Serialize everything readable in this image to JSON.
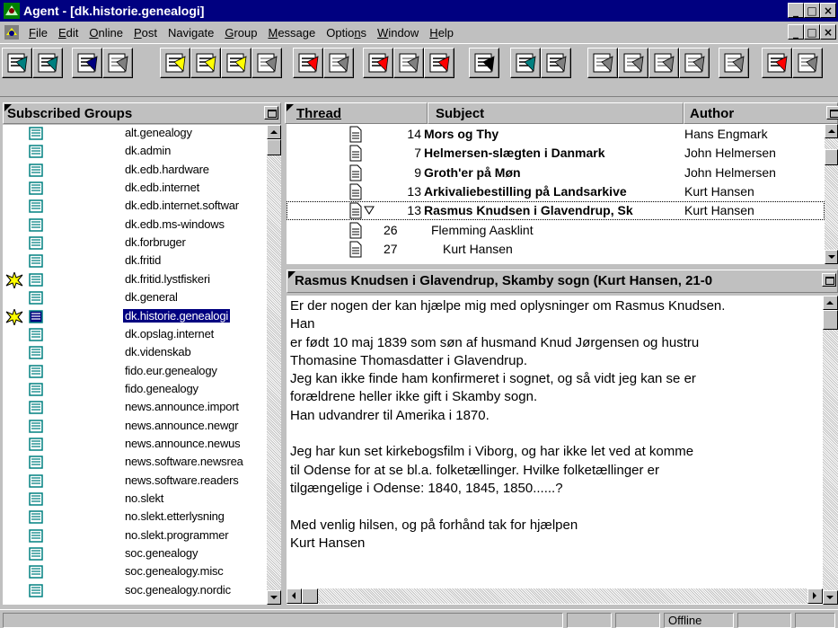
{
  "window": {
    "title": "Agent - [dk.historie.genealogi]"
  },
  "menu": [
    {
      "label": "File",
      "u": "F"
    },
    {
      "label": "Edit",
      "u": "E"
    },
    {
      "label": "Online",
      "u": "O"
    },
    {
      "label": "Post",
      "u": "P"
    },
    {
      "label": "Navigate",
      "u": "g"
    },
    {
      "label": "Group",
      "u": "G"
    },
    {
      "label": "Message",
      "u": "M"
    },
    {
      "label": "Options",
      "u": "n"
    },
    {
      "label": "Window",
      "u": "W"
    },
    {
      "label": "Help",
      "u": "H"
    }
  ],
  "groups_pane": {
    "title": "Subscribed Groups",
    "items": [
      {
        "name": "alt.genealogy"
      },
      {
        "name": "dk.admin"
      },
      {
        "name": "dk.edb.hardware"
      },
      {
        "name": "dk.edb.internet"
      },
      {
        "name": "dk.edb.internet.softwar"
      },
      {
        "name": "dk.edb.ms-windows"
      },
      {
        "name": "dk.forbruger"
      },
      {
        "name": "dk.fritid"
      },
      {
        "name": "dk.fritid.lystfiskeri",
        "new": true
      },
      {
        "name": "dk.general"
      },
      {
        "name": "dk.historie.genealogi",
        "new": true,
        "selected": true
      },
      {
        "name": "dk.opslag.internet"
      },
      {
        "name": "dk.videnskab"
      },
      {
        "name": "fido.eur.genealogy"
      },
      {
        "name": "fido.genealogy"
      },
      {
        "name": "news.announce.import"
      },
      {
        "name": "news.announce.newgr"
      },
      {
        "name": "news.announce.newus"
      },
      {
        "name": "news.software.newsrea"
      },
      {
        "name": "news.software.readers"
      },
      {
        "name": "no.slekt"
      },
      {
        "name": "no.slekt.etterlysning"
      },
      {
        "name": "no.slekt.programmer"
      },
      {
        "name": "soc.genealogy"
      },
      {
        "name": "soc.genealogy.misc"
      },
      {
        "name": "soc.genealogy.nordic"
      }
    ]
  },
  "thread_pane": {
    "columns": {
      "thread": "Thread",
      "subject": "Subject",
      "author": "Author"
    },
    "rows": [
      {
        "num": "14",
        "subject": "Mors og Thy",
        "author": "Hans Engmark",
        "bold": true,
        "indent": 0
      },
      {
        "num": "7",
        "subject": "Helmersen-slægten i Danmark",
        "author": "John Helmersen",
        "bold": true,
        "indent": 0
      },
      {
        "num": "9",
        "subject": "Groth'er på Møn",
        "author": "John Helmersen",
        "bold": true,
        "indent": 0
      },
      {
        "num": "13",
        "subject": "Arkivaliebestilling på Landsarkive",
        "author": "Kurt Hansen",
        "bold": true,
        "indent": 0
      },
      {
        "num": "13",
        "subject": "Rasmus Knudsen i Glavendrup, Sk",
        "author": "Kurt Hansen",
        "bold": true,
        "indent": 0,
        "expanded": true,
        "focus": true
      },
      {
        "num": "26",
        "subject": "Flemming Aasklint",
        "author": "",
        "bold": false,
        "indent": 1
      },
      {
        "num": "27",
        "subject": "Kurt Hansen",
        "author": "",
        "bold": false,
        "indent": 2
      }
    ]
  },
  "message": {
    "header": "Rasmus Knudsen i Glavendrup, Skamby sogn (Kurt Hansen, 21-0",
    "lines": [
      "Er der nogen der kan hjælpe mig med oplysninger om Rasmus Knudsen.",
      "Han",
      "er født 10 maj 1839 som søn af husmand Knud Jørgensen og hustru",
      "Thomasine Thomasdatter i Glavendrup.",
      "Jeg kan ikke finde ham konfirmeret i sognet, og så vidt jeg kan se er",
      "forældrene heller ikke gift i Skamby sogn.",
      "Han udvandrer til Amerika i 1870.",
      "",
      "Jeg har kun set kirkebogsfilm i Viborg, og har ikke let ved at komme",
      "til Odense for at se bl.a. folketællinger. Hvilke folketællinger er",
      "tilgængelige i Odense: 1840, 1845, 1850......?",
      "",
      "Med venlig hilsen, og på forhånd tak for hjælpen",
      "Kurt Hansen"
    ]
  },
  "status": {
    "connection": "Offline"
  },
  "toolbar": {
    "buttons": [
      {
        "icon": "group-list-icon"
      },
      {
        "icon": "new-groups-icon"
      },
      {
        "icon": "retrieve-headers-icon"
      },
      {
        "icon": "retrieve-bodies-icon"
      },
      {
        "icon": "post-article-icon"
      },
      {
        "icon": "followup-icon"
      },
      {
        "icon": "reply-icon"
      },
      {
        "icon": "forward-icon"
      },
      {
        "icon": "next-unread-icon"
      },
      {
        "icon": "skip-thread-icon"
      },
      {
        "icon": "mark-read-icon"
      },
      {
        "icon": "mark-unread-icon"
      },
      {
        "icon": "delete-icon"
      },
      {
        "icon": "rot13-icon"
      },
      {
        "icon": "flashlight-icon"
      },
      {
        "icon": "sort-icon"
      },
      {
        "icon": "sort-down-icon"
      },
      {
        "icon": "watch-icon"
      },
      {
        "icon": "lock-icon"
      },
      {
        "icon": "ignore-icon"
      },
      {
        "icon": "music-note-icon"
      },
      {
        "icon": "online-antenna-icon"
      },
      {
        "icon": "stop-icon"
      }
    ]
  },
  "colors": {
    "selection": "#000080",
    "face": "#c0c0c0",
    "new_star": "#ffff00"
  }
}
